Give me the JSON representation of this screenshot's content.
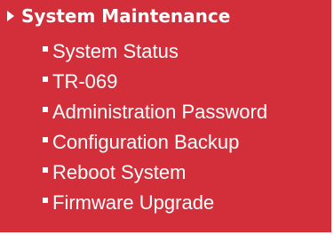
{
  "section": {
    "title": "System Maintenance",
    "icon": "triangle-right-icon"
  },
  "menu": {
    "items": [
      {
        "label": "System Status"
      },
      {
        "label": "TR-069"
      },
      {
        "label": "Administration Password"
      },
      {
        "label": "Configuration Backup"
      },
      {
        "label": "Reboot System"
      },
      {
        "label": "Firmware Upgrade"
      }
    ]
  },
  "colors": {
    "panel_background": "#d22f3a",
    "text": "#ffffff"
  }
}
